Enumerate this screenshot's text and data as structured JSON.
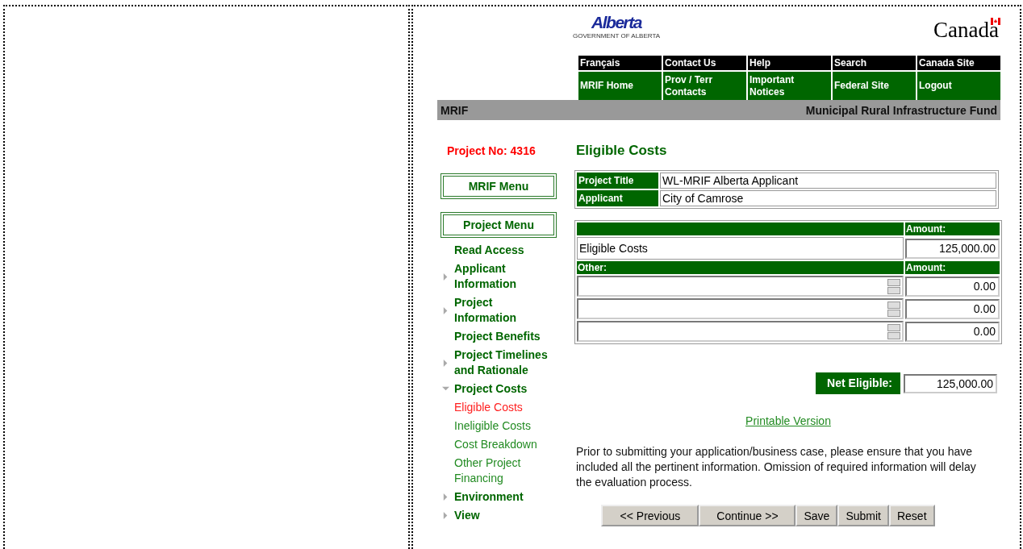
{
  "header": {
    "province_logo": {
      "wordmark": "Alberta",
      "tagline": "GOVERNMENT OF ALBERTA"
    },
    "canada_wordmark": "Canada"
  },
  "top_nav": [
    [
      "Français",
      "Contact Us",
      "Help",
      "Search",
      "Canada Site"
    ],
    [
      "MRIF Home",
      "Prov / Terr Contacts",
      "Important Notices",
      "Federal Site",
      "Logout"
    ]
  ],
  "banner": {
    "left": "MRIF",
    "right": "Municipal Rural Infrastructure Fund"
  },
  "sidebar": {
    "project_no_label": "Project No:",
    "project_no": "4316",
    "menu_boxes": [
      "MRIF Menu",
      "Project Menu"
    ],
    "items": [
      {
        "label": "Read Access"
      },
      {
        "label": "Applicant Information",
        "expanded": false
      },
      {
        "label": "Project Information",
        "expanded": false
      },
      {
        "label": "Project Benefits"
      },
      {
        "label": "Project Timelines and Rationale",
        "expanded": false
      },
      {
        "label": "Project Costs",
        "expanded": true,
        "children": [
          {
            "label": "Eligible Costs",
            "selected": true
          },
          {
            "label": "Ineligible Costs",
            "selected": false
          },
          {
            "label": "Cost Breakdown",
            "selected": false
          },
          {
            "label": "Other Project Financing",
            "selected": false
          }
        ]
      },
      {
        "label": "Environment",
        "expanded": false
      },
      {
        "label": "View",
        "expanded": false
      }
    ]
  },
  "page_title": "Eligible Costs",
  "info": [
    {
      "label": "Project Title",
      "value": "WL-MRIF Alberta Applicant"
    },
    {
      "label": "Applicant",
      "value": "City of Camrose"
    }
  ],
  "costs": {
    "header": {
      "amount": "Amount:"
    },
    "rows": [
      {
        "label": "Eligible Costs",
        "amount": "125,000.00"
      }
    ],
    "other_header": {
      "label": "Other:",
      "amount": "Amount:"
    },
    "other_rows": [
      {
        "amount": "0.00"
      },
      {
        "amount": "0.00"
      },
      {
        "amount": "0.00"
      }
    ]
  },
  "net_eligible": {
    "label": "Net Eligible:",
    "value": "125,000.00"
  },
  "printable_link": "Printable Version",
  "notice": "Prior to submitting your application/business case, please ensure that you have included all the pertinent information. Omission of required information will delay the evaluation process.",
  "buttons": [
    "<< Previous",
    "Continue >>",
    "Save",
    "Submit",
    "Reset"
  ]
}
